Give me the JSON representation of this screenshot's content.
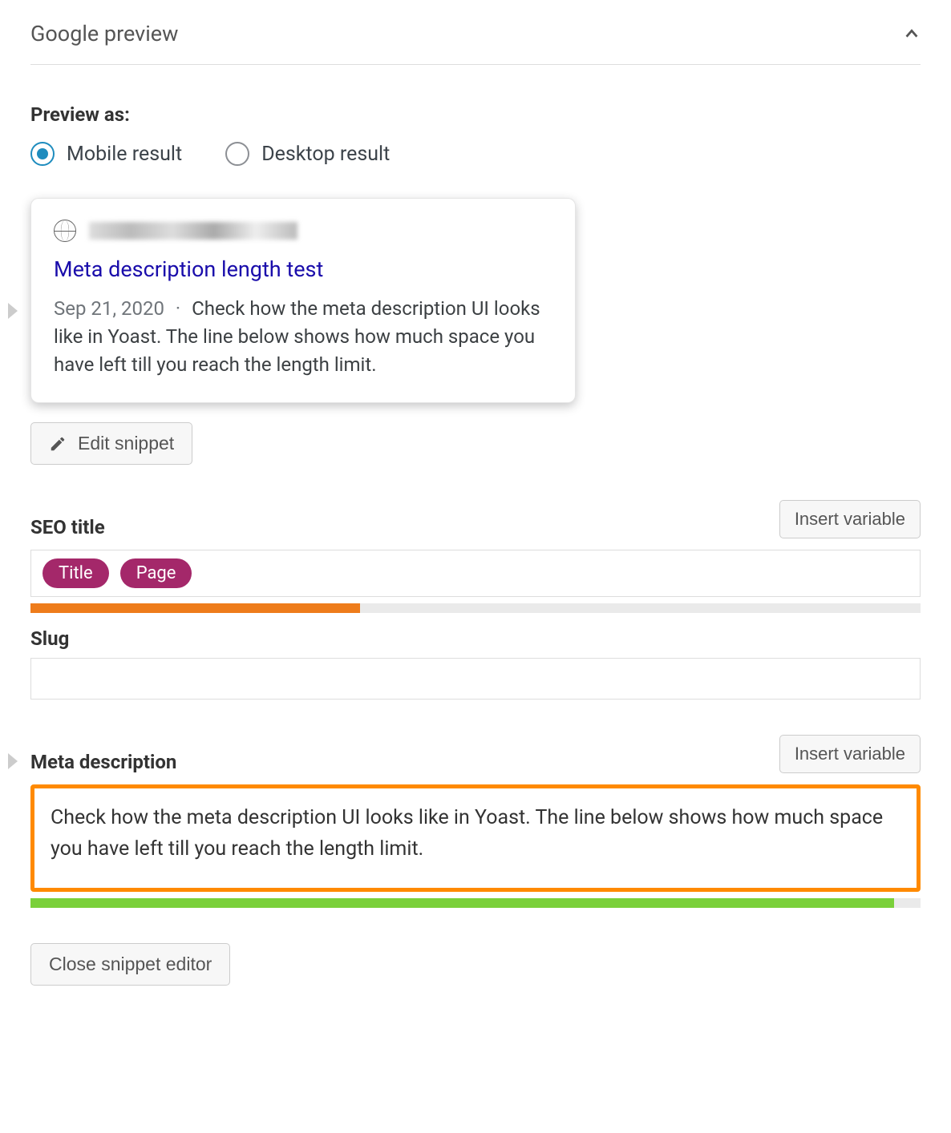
{
  "header": {
    "title": "Google preview"
  },
  "preview_as": {
    "label": "Preview as:",
    "options": {
      "mobile": "Mobile result",
      "desktop": "Desktop result"
    }
  },
  "snippet": {
    "title": "Meta description length test",
    "date": "Sep 21, 2020",
    "description": "Check how the meta description UI looks like in Yoast. The line below shows how much space you have left till you reach the length limit.",
    "edit_button": "Edit snippet"
  },
  "seo_title": {
    "label": "SEO title",
    "insert_variable": "Insert variable",
    "pills": {
      "title": "Title",
      "page": "Page"
    },
    "progress_percent": 37,
    "progress_color": "#ee7c1b"
  },
  "slug": {
    "label": "Slug",
    "value": ""
  },
  "meta_description": {
    "label": "Meta description",
    "insert_variable": "Insert variable",
    "value": "Check how the meta description UI looks like in Yoast. The line below shows how much space you have left till you reach the length limit.",
    "progress_percent": 97,
    "progress_color": "#7ad03a"
  },
  "close_button": "Close snippet editor"
}
